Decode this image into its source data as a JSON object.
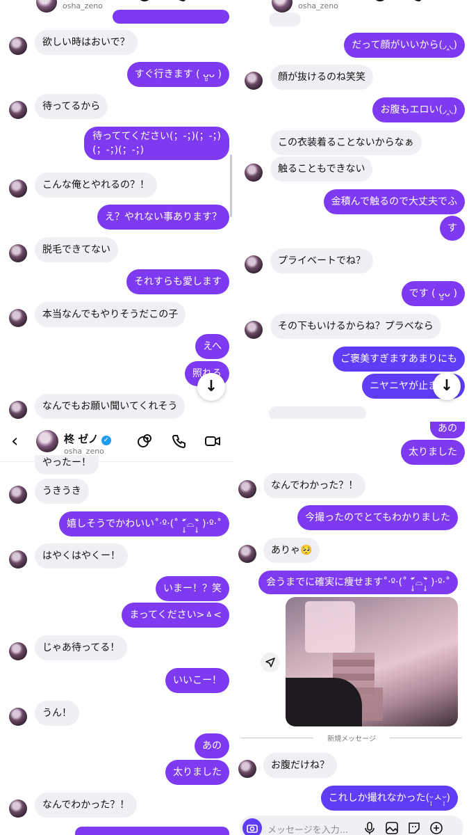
{
  "colors": {
    "outgoing": "#7d3af0",
    "outgoing_alt": "#5f3df6",
    "incoming": "#eff0f3",
    "verified": "#1d9bf0"
  },
  "header": {
    "name": "柊 ゼノ",
    "username": "osha_zeno",
    "back_icon": "chevron-left-icon",
    "icons": [
      "new-effect-icon",
      "phone-icon",
      "video-camera-icon"
    ]
  },
  "panel1": {
    "username": "osha_zeno",
    "messages": [
      {
        "side": "in",
        "text": "欲しい時はおいで？"
      },
      {
        "side": "out",
        "text": "すぐ行きます ( ᴗ̤̮ᴗ )"
      },
      {
        "side": "in",
        "text": "待ってるから"
      },
      {
        "side": "out",
        "text": "待っててください(；-；)(；-；)\n(；-；)(；-；)"
      },
      {
        "side": "in",
        "text": "こんな俺とやれるの？！"
      },
      {
        "side": "out",
        "text": "え？やれない事あります？"
      },
      {
        "side": "in",
        "text": "脱毛できてない"
      },
      {
        "side": "out",
        "text": "それすらも愛します"
      },
      {
        "side": "in",
        "text": "本当なんでもやりそうだこの子"
      },
      {
        "side": "out",
        "text": "えへ"
      },
      {
        "side": "out",
        "text": "照れる"
      },
      {
        "side": "in",
        "text": "なんでもお願い聞いてくれそう"
      }
    ]
  },
  "panel2": {
    "username": "osha_zeno",
    "messages": [
      {
        "side": "out",
        "text": "だって顔がいいから(◞‸◟)"
      },
      {
        "side": "in",
        "text": "顔が抜けるのね笑笑"
      },
      {
        "side": "out",
        "text": "お腹もエロい(◞‸◟)"
      },
      {
        "side": "in",
        "text": "この衣装着ることないからなぁ"
      },
      {
        "side": "in",
        "text": "触ることもできない"
      },
      {
        "side": "out",
        "text": "金積んで触るので大丈夫でふ"
      },
      {
        "side": "out",
        "text": "す"
      },
      {
        "side": "in",
        "text": "プライベートでね？"
      },
      {
        "side": "out",
        "text": "です ( ᴗ̤̮ᴗ )"
      },
      {
        "side": "in",
        "text": "その下もいけるからね？プラベなら"
      },
      {
        "side": "out",
        "text": "ご褒美すぎますあまりにも"
      },
      {
        "side": "out",
        "text": "ニヤニヤが止まりま"
      }
    ]
  },
  "panel3": {
    "messages": [
      {
        "side": "in",
        "text": "やったー！"
      },
      {
        "side": "in",
        "text": "うきうき"
      },
      {
        "side": "out",
        "text": "嬉しそうでかわいい˚‧º·(˚ ˃̣̣̥᷄⌓˂̣̣̥᷅ )‧º·˚"
      },
      {
        "side": "in",
        "text": "はやくはやくー！"
      },
      {
        "side": "out",
        "text": "いまー！？笑"
      },
      {
        "side": "out",
        "text": "まってください>ㅿ<"
      },
      {
        "side": "in",
        "text": "じゃあ待ってる！"
      },
      {
        "side": "out",
        "text": "いいこー！"
      },
      {
        "side": "in",
        "text": "うん！"
      },
      {
        "side": "out",
        "text": "あの"
      },
      {
        "side": "out",
        "text": "太りました"
      },
      {
        "side": "in",
        "text": "なんでわかった？！"
      }
    ]
  },
  "panel4": {
    "messages": [
      {
        "side": "out",
        "text": "あの"
      },
      {
        "side": "out",
        "text": "太りました"
      },
      {
        "side": "in",
        "text": "なんでわかった？！"
      },
      {
        "side": "out",
        "text": "今撮ったのでとてもわかりました"
      },
      {
        "side": "in",
        "text": "ありゃ🥺"
      },
      {
        "side": "out",
        "text": "会うまでに確実に痩せます˚‧º·(˚ ˃̣̣̥᷄⌓˂̣̣̥᷅ )‧º·˚"
      },
      {
        "side": "in",
        "text": "お腹だけね？"
      },
      {
        "side": "out",
        "text": "これしか撮れなかった(ᵕ̩̩ㅅᵕ̩̩)"
      }
    ],
    "divider": "新規メッセージ",
    "input_placeholder": "メッセージを入力...",
    "input_icons": [
      "camera-icon",
      "microphone-icon",
      "gallery-icon",
      "sticker-icon",
      "plus-icon"
    ]
  }
}
